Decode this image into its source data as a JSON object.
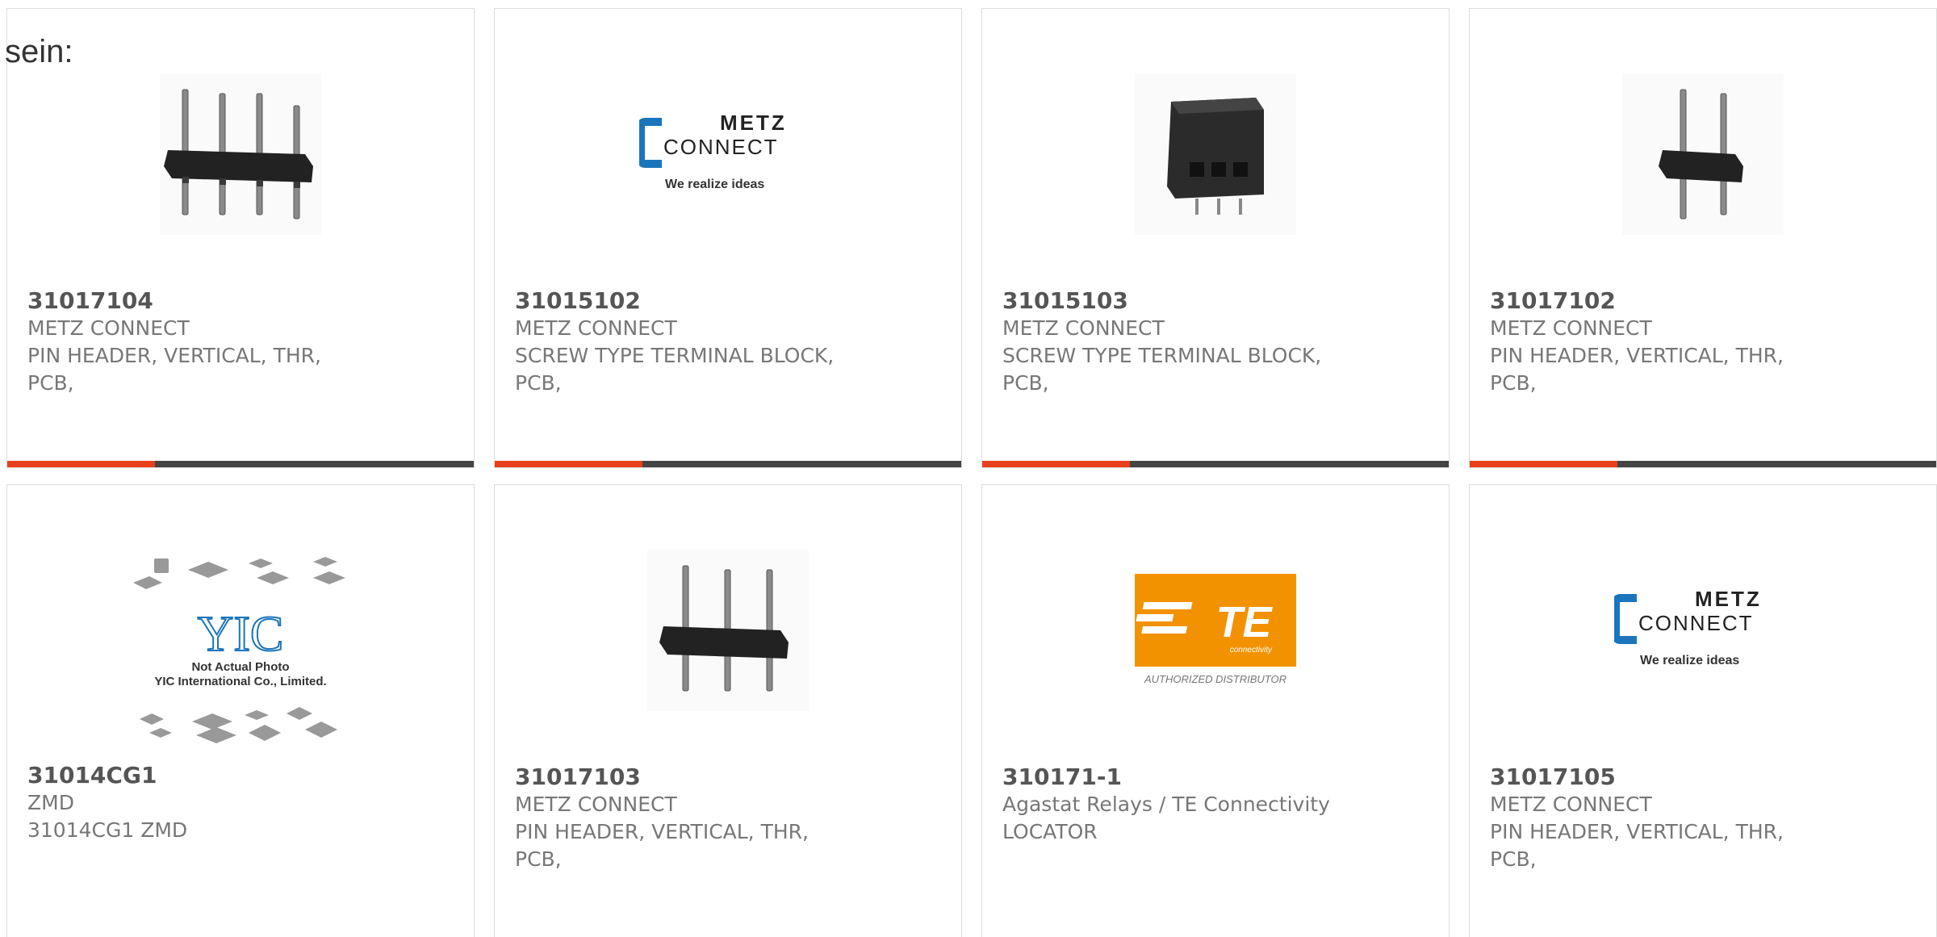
{
  "intro_text": "sein:",
  "colors": {
    "accent": "#e8401c",
    "bar": "#444444",
    "border": "#dddddd",
    "metz_blue": "#1b75bc",
    "te_orange": "#f39200"
  },
  "products": [
    {
      "part_number": "31017104",
      "manufacturer": "METZ CONNECT",
      "description": "PIN HEADER, VERTICAL, THR,",
      "description2": "PCB,",
      "image": "pin-header-4"
    },
    {
      "part_number": "31015102",
      "manufacturer": "METZ CONNECT",
      "description": "SCREW TYPE TERMINAL BLOCK,",
      "description2": "PCB,",
      "image": "metz-logo"
    },
    {
      "part_number": "31015103",
      "manufacturer": "METZ CONNECT",
      "description": "SCREW TYPE TERMINAL BLOCK,",
      "description2": "PCB,",
      "image": "terminal-block"
    },
    {
      "part_number": "31017102",
      "manufacturer": "METZ CONNECT",
      "description": "PIN HEADER, VERTICAL, THR,",
      "description2": "PCB,",
      "image": "pin-header-2"
    },
    {
      "part_number": "31014CG1",
      "manufacturer": "ZMD",
      "description": "31014CG1 ZMD",
      "description2": "",
      "image": "yic-placeholder"
    },
    {
      "part_number": "31017103",
      "manufacturer": "METZ CONNECT",
      "description": "PIN HEADER, VERTICAL, THR,",
      "description2": "PCB,",
      "image": "pin-header-3"
    },
    {
      "part_number": "310171-1",
      "manufacturer": "Agastat Relays / TE Connectivity",
      "description": "LOCATOR",
      "description2": "",
      "image": "te-logo"
    },
    {
      "part_number": "31017105",
      "manufacturer": "METZ CONNECT",
      "description": "PIN HEADER, VERTICAL, THR,",
      "description2": "PCB,",
      "image": "metz-logo"
    }
  ],
  "logos": {
    "metz_top": "METZ",
    "metz_bottom": "CONNECT",
    "metz_tagline": "We realize ideas",
    "te_main": "TE",
    "te_sub": "connectivity",
    "te_tagline": "AUTHORIZED DISTRIBUTOR",
    "yic_line1": "Not Actual Photo",
    "yic_line2": "YIC International Co., Limited.",
    "yic_mark": "YIC"
  }
}
